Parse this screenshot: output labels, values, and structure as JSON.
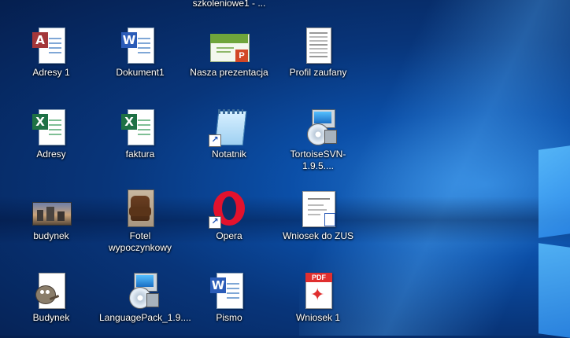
{
  "top_caption": "szkoleniowe1 - ...",
  "icons": [
    {
      "label": "Adresy 1",
      "icon": "access-database-icon"
    },
    {
      "label": "Dokument1",
      "icon": "word-document-icon"
    },
    {
      "label": "Nasza prezentacja",
      "icon": "powerpoint-presentation-icon"
    },
    {
      "label": "Profil zaufany",
      "icon": "scanned-document-icon"
    },
    {
      "label": "Adresy",
      "icon": "excel-spreadsheet-icon"
    },
    {
      "label": "faktura",
      "icon": "excel-spreadsheet-icon"
    },
    {
      "label": "Notatnik",
      "icon": "notepad-icon"
    },
    {
      "label": "TortoiseSVN-1.9.5....",
      "icon": "installer-icon"
    },
    {
      "label": "budynek",
      "icon": "image-thumbnail-icon"
    },
    {
      "label": "Fotel\nwypoczynkowy",
      "icon": "image-thumbnail-icon"
    },
    {
      "label": "Opera",
      "icon": "opera-browser-icon"
    },
    {
      "label": "Wniosek do ZUS",
      "icon": "document-thumbnail-icon"
    },
    {
      "label": "Budynek",
      "icon": "gimp-icon"
    },
    {
      "label": "LanguagePack_1.9....",
      "icon": "installer-icon"
    },
    {
      "label": "Pismo",
      "icon": "word-document-icon"
    },
    {
      "label": "Wniosek 1",
      "icon": "pdf-document-icon"
    }
  ],
  "colors": {
    "word": "#2b5cb8",
    "excel": "#1e7145",
    "access": "#a4373a",
    "powerpoint": "#d24726",
    "pdf": "#e02f2f",
    "opera": "#e3122d"
  }
}
